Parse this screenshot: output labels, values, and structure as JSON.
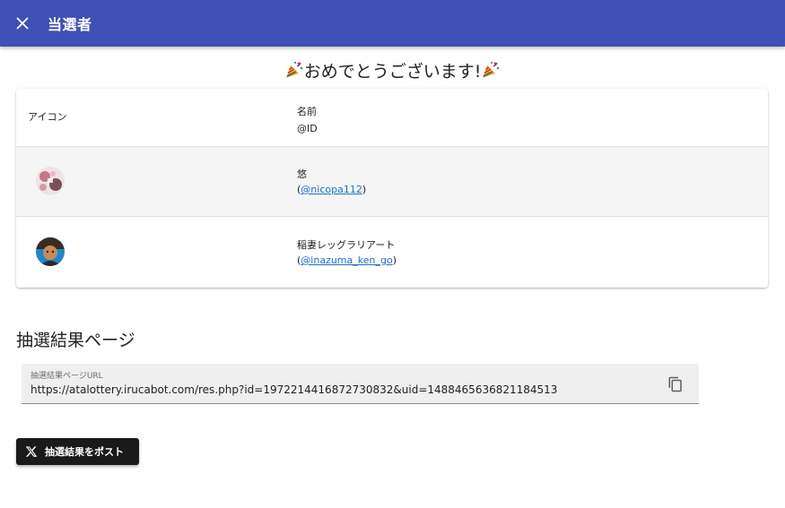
{
  "header": {
    "title": "当選者",
    "close_icon": "close-icon"
  },
  "congrats": {
    "text": "おめでとうございます!",
    "icon": "party-popper-icon"
  },
  "table": {
    "headers": {
      "icon": "アイコン",
      "name": "名前",
      "id": "@ID"
    },
    "rows": [
      {
        "name": "悠",
        "id_open": "(",
        "handle": "@nicopa112",
        "id_close": ")"
      },
      {
        "name": "稲妻レッグラリアート",
        "id_open": "(",
        "handle": "@inazuma_ken_go",
        "id_close": ")"
      }
    ]
  },
  "results_page": {
    "title": "抽選結果ページ",
    "url_label": "抽選結果ページURL",
    "url": "https://atalottery.irucabot.com/res.php?id=1972214416872730832&uid=1488465636821184513",
    "copy_icon": "copy-icon"
  },
  "post_button": {
    "label": "抽選結果をポスト",
    "icon": "x-logo-icon"
  },
  "colors": {
    "header_bg": "#3f51b5",
    "link": "#1e6fc9",
    "button_bg": "#1a1a1a"
  }
}
